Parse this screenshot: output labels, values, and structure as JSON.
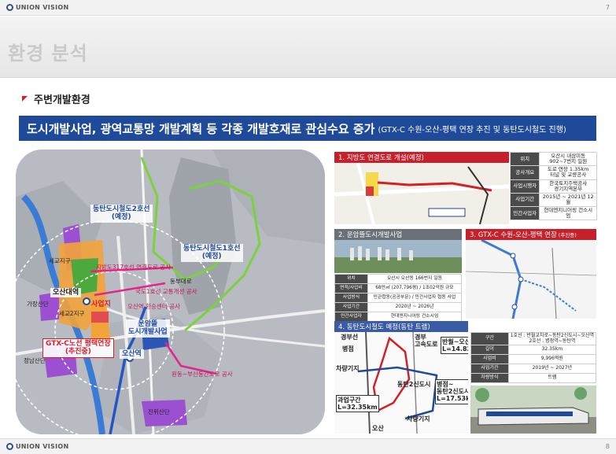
{
  "header": {
    "brand": "UNION VISION",
    "page_top": "7",
    "page_bottom": "8"
  },
  "title": "환경 분석",
  "section": "주변개발환경",
  "banner": {
    "main": "도시개발사업, 광역교통망 개발계획 등 각종 개발호재로 관심수요 증가",
    "sub": "(GTX-C 수원-오산-평택 연장 추진 및 동탄도시철도 진행)"
  },
  "map": {
    "labels": {
      "dongtan2": "동탄도시철도2호선\n(예정)",
      "dongtan1": "동탄도시철도1호선\n(예정)",
      "osan_station_main": "오산대역",
      "site": "사업지",
      "gtx": "GTX-C노선 평택연장\n(추진중)",
      "osan_station": "오산역",
      "unam": "운암뜰\n도시개발사업",
      "sewa": "세교지구",
      "sewa2": "세교2지구",
      "gajang": "가장산단",
      "jungdang": "정남산단",
      "jinwi": "진위산단",
      "road1": "지방도317호선 연결도로 공사",
      "road2": "국도1호선 교통개선 공사",
      "road3": "오산역 환승센터 공사",
      "road4": "원동~부산동간도로 공사",
      "dongbu": "동부대로"
    }
  },
  "panels": {
    "p1": {
      "title": "1. 지방도 연결도로 개설(예정)",
      "table": [
        [
          "위치",
          "오산시 내삼미동\n902~7번지 일원"
        ],
        [
          "공사개요",
          "도로 연장 1.35km\n터널 및 교량공사"
        ],
        [
          "사업시행자",
          "한국토지주택공사\n경기지역본부"
        ],
        [
          "사업기간",
          "2015년 ~ 2021년 12월"
        ],
        [
          "민간사업자",
          "현대엔지니어링 건소시엄"
        ]
      ]
    },
    "p2": {
      "title": "2. 운암뜰도시개발사업",
      "table": [
        [
          "위치",
          "오산시 오산동 166번지 일원"
        ],
        [
          "면적/사업비",
          "68만㎡ (207,796평) / 1조02억원 규모"
        ],
        [
          "사업방식",
          "민관합동(공공부문) / 민간사업자 협동 사업"
        ],
        [
          "사업기간",
          "2020년 ~ 2026년"
        ],
        [
          "민간사업자",
          "현대엔지니어링 건소시엄"
        ]
      ]
    },
    "p3": {
      "title": "3. GTX-C 수원-오산-평택 연장",
      "note": "(추진중)"
    },
    "p4": {
      "title": "4. 동탄도시철도 예정(동탄 트램)",
      "map_labels": {
        "gyeongbu": "경부선",
        "byeongjeom": "병점",
        "depot1": "차량기지",
        "gwayeop": "과업구간\nL=32.35km",
        "osan": "오산",
        "expressway": "경부\n고속도로",
        "banwol": "반월~오산\nL=14.82km",
        "dongtan2": "동탄2신도시",
        "byeongjeom2": "병점~\n동탄2신도시\nL=17.53km",
        "depot2": "차량기지"
      },
      "table": [
        [
          "구간",
          "1호선 : 반월교차로~동탄2신도시~오산역\n2호선 : 병점역~동탄역"
        ],
        [
          "길이",
          "32.35km"
        ],
        [
          "사업비",
          "9,996억원"
        ],
        [
          "사업기간",
          "2019년 ~ 2027년"
        ],
        [
          "차량방식",
          "트램"
        ]
      ]
    }
  }
}
